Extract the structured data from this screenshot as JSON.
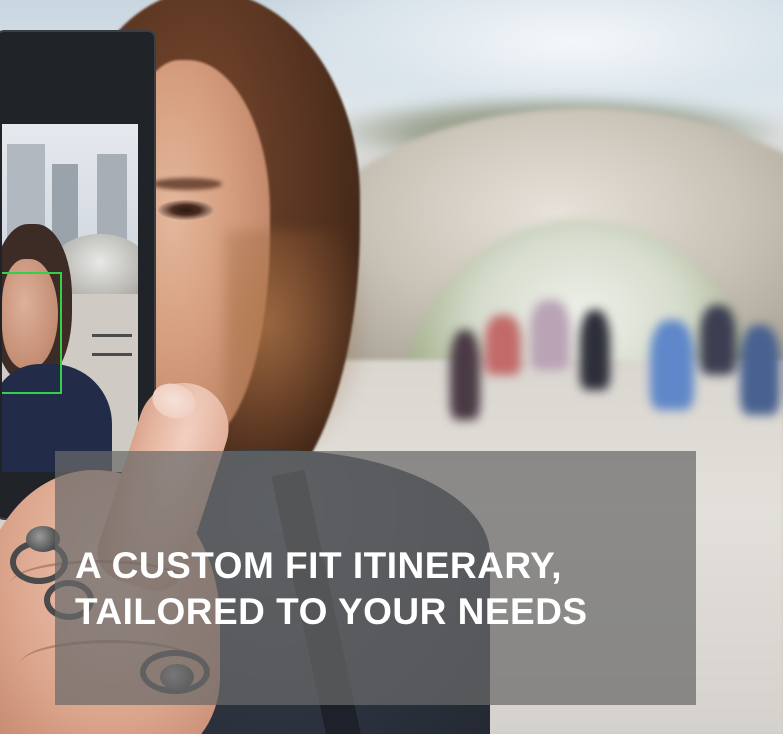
{
  "caption": {
    "line1": "A CUSTOM FIT ITINERARY,",
    "line2": "TAILORED TO YOUR NEEDS"
  },
  "colors": {
    "overlay": "#696969",
    "text": "#ffffff",
    "face_detection_box": "#35d04a"
  }
}
